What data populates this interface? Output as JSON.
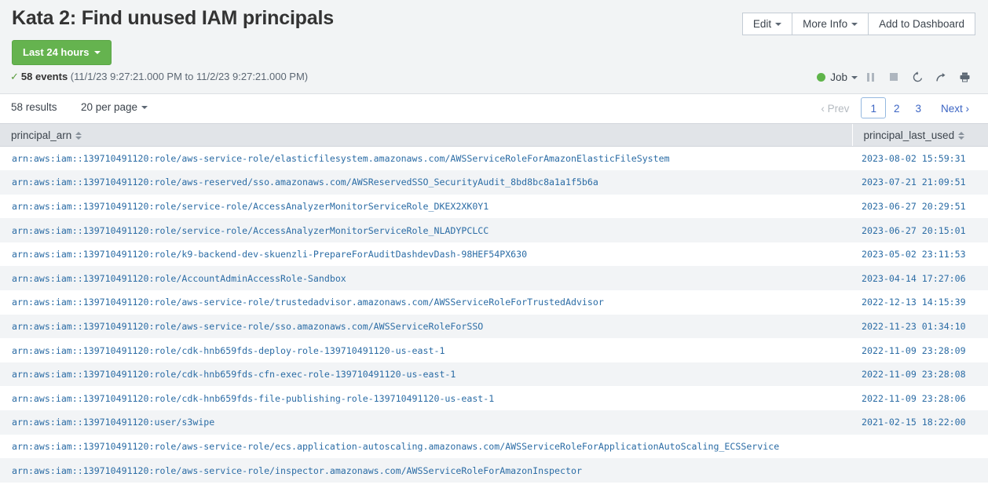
{
  "header": {
    "title": "Kata 2: Find unused IAM principals",
    "buttons": [
      {
        "label": "Edit",
        "name": "edit-button",
        "caret": true
      },
      {
        "label": "More Info",
        "name": "more-info-button",
        "caret": true
      },
      {
        "label": "Add to Dashboard",
        "name": "add-to-dashboard-button",
        "caret": false
      }
    ],
    "timepicker": {
      "label": "Last 24 hours"
    },
    "events": {
      "check": "✓",
      "count": "58 events",
      "range": "(11/1/23 9:27:21.000 PM to 11/2/23 9:27:21.000 PM)"
    },
    "job": {
      "label": "Job",
      "status_color": "#5fb44a",
      "icons": [
        {
          "name": "pause-icon",
          "glyph": "pause"
        },
        {
          "name": "stop-icon",
          "glyph": "stop"
        },
        {
          "name": "refresh-icon",
          "glyph": "↺"
        },
        {
          "name": "share-icon",
          "glyph": "↗"
        },
        {
          "name": "print-icon",
          "glyph": "⎙"
        }
      ]
    }
  },
  "results_bar": {
    "count_label": "58 results",
    "per_page_label": "20 per page",
    "pagination": {
      "prev_label": "Prev",
      "next_label": "Next",
      "pages": [
        "1",
        "2",
        "3"
      ],
      "current": "1"
    }
  },
  "table": {
    "columns": [
      {
        "key": "principal_arn",
        "label": "principal_arn"
      },
      {
        "key": "principal_last_used",
        "label": "principal_last_used"
      }
    ],
    "rows": [
      {
        "principal_arn": "arn:aws:iam::139710491120:role/aws-service-role/elasticfilesystem.amazonaws.com/AWSServiceRoleForAmazonElasticFileSystem",
        "principal_last_used": "2023-08-02 15:59:31"
      },
      {
        "principal_arn": "arn:aws:iam::139710491120:role/aws-reserved/sso.amazonaws.com/AWSReservedSSO_SecurityAudit_8bd8bc8a1a1f5b6a",
        "principal_last_used": "2023-07-21 21:09:51"
      },
      {
        "principal_arn": "arn:aws:iam::139710491120:role/service-role/AccessAnalyzerMonitorServiceRole_DKEX2XK0Y1",
        "principal_last_used": "2023-06-27 20:29:51"
      },
      {
        "principal_arn": "arn:aws:iam::139710491120:role/service-role/AccessAnalyzerMonitorServiceRole_NLADYPCLCC",
        "principal_last_used": "2023-06-27 20:15:01"
      },
      {
        "principal_arn": "arn:aws:iam::139710491120:role/k9-backend-dev-skuenzli-PrepareForAuditDashdevDash-98HEF54PX630",
        "principal_last_used": "2023-05-02 23:11:53"
      },
      {
        "principal_arn": "arn:aws:iam::139710491120:role/AccountAdminAccessRole-Sandbox",
        "principal_last_used": "2023-04-14 17:27:06"
      },
      {
        "principal_arn": "arn:aws:iam::139710491120:role/aws-service-role/trustedadvisor.amazonaws.com/AWSServiceRoleForTrustedAdvisor",
        "principal_last_used": "2022-12-13 14:15:39"
      },
      {
        "principal_arn": "arn:aws:iam::139710491120:role/aws-service-role/sso.amazonaws.com/AWSServiceRoleForSSO",
        "principal_last_used": "2022-11-23 01:34:10"
      },
      {
        "principal_arn": "arn:aws:iam::139710491120:role/cdk-hnb659fds-deploy-role-139710491120-us-east-1",
        "principal_last_used": "2022-11-09 23:28:09"
      },
      {
        "principal_arn": "arn:aws:iam::139710491120:role/cdk-hnb659fds-cfn-exec-role-139710491120-us-east-1",
        "principal_last_used": "2022-11-09 23:28:08"
      },
      {
        "principal_arn": "arn:aws:iam::139710491120:role/cdk-hnb659fds-file-publishing-role-139710491120-us-east-1",
        "principal_last_used": "2022-11-09 23:28:06"
      },
      {
        "principal_arn": "arn:aws:iam::139710491120:user/s3wipe",
        "principal_last_used": "2021-02-15 18:22:00"
      },
      {
        "principal_arn": "arn:aws:iam::139710491120:role/aws-service-role/ecs.application-autoscaling.amazonaws.com/AWSServiceRoleForApplicationAutoScaling_ECSService",
        "principal_last_used": ""
      },
      {
        "principal_arn": "arn:aws:iam::139710491120:role/aws-service-role/inspector.amazonaws.com/AWSServiceRoleForAmazonInspector",
        "principal_last_used": ""
      }
    ]
  }
}
